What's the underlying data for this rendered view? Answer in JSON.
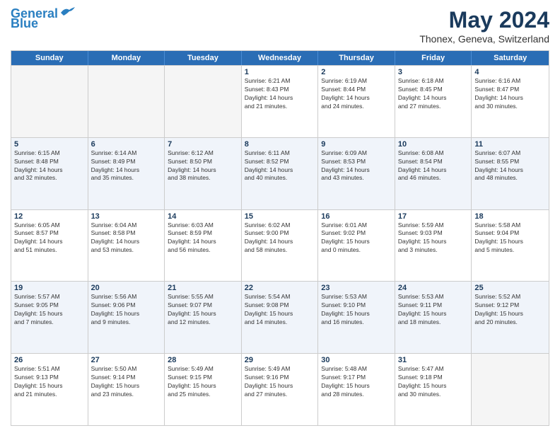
{
  "header": {
    "logo_line1": "General",
    "logo_line2": "Blue",
    "month_year": "May 2024",
    "location": "Thonex, Geneva, Switzerland"
  },
  "days_of_week": [
    "Sunday",
    "Monday",
    "Tuesday",
    "Wednesday",
    "Thursday",
    "Friday",
    "Saturday"
  ],
  "rows": [
    [
      {
        "day": "",
        "lines": []
      },
      {
        "day": "",
        "lines": []
      },
      {
        "day": "",
        "lines": []
      },
      {
        "day": "1",
        "lines": [
          "Sunrise: 6:21 AM",
          "Sunset: 8:43 PM",
          "Daylight: 14 hours",
          "and 21 minutes."
        ]
      },
      {
        "day": "2",
        "lines": [
          "Sunrise: 6:19 AM",
          "Sunset: 8:44 PM",
          "Daylight: 14 hours",
          "and 24 minutes."
        ]
      },
      {
        "day": "3",
        "lines": [
          "Sunrise: 6:18 AM",
          "Sunset: 8:45 PM",
          "Daylight: 14 hours",
          "and 27 minutes."
        ]
      },
      {
        "day": "4",
        "lines": [
          "Sunrise: 6:16 AM",
          "Sunset: 8:47 PM",
          "Daylight: 14 hours",
          "and 30 minutes."
        ]
      }
    ],
    [
      {
        "day": "5",
        "lines": [
          "Sunrise: 6:15 AM",
          "Sunset: 8:48 PM",
          "Daylight: 14 hours",
          "and 32 minutes."
        ]
      },
      {
        "day": "6",
        "lines": [
          "Sunrise: 6:14 AM",
          "Sunset: 8:49 PM",
          "Daylight: 14 hours",
          "and 35 minutes."
        ]
      },
      {
        "day": "7",
        "lines": [
          "Sunrise: 6:12 AM",
          "Sunset: 8:50 PM",
          "Daylight: 14 hours",
          "and 38 minutes."
        ]
      },
      {
        "day": "8",
        "lines": [
          "Sunrise: 6:11 AM",
          "Sunset: 8:52 PM",
          "Daylight: 14 hours",
          "and 40 minutes."
        ]
      },
      {
        "day": "9",
        "lines": [
          "Sunrise: 6:09 AM",
          "Sunset: 8:53 PM",
          "Daylight: 14 hours",
          "and 43 minutes."
        ]
      },
      {
        "day": "10",
        "lines": [
          "Sunrise: 6:08 AM",
          "Sunset: 8:54 PM",
          "Daylight: 14 hours",
          "and 46 minutes."
        ]
      },
      {
        "day": "11",
        "lines": [
          "Sunrise: 6:07 AM",
          "Sunset: 8:55 PM",
          "Daylight: 14 hours",
          "and 48 minutes."
        ]
      }
    ],
    [
      {
        "day": "12",
        "lines": [
          "Sunrise: 6:05 AM",
          "Sunset: 8:57 PM",
          "Daylight: 14 hours",
          "and 51 minutes."
        ]
      },
      {
        "day": "13",
        "lines": [
          "Sunrise: 6:04 AM",
          "Sunset: 8:58 PM",
          "Daylight: 14 hours",
          "and 53 minutes."
        ]
      },
      {
        "day": "14",
        "lines": [
          "Sunrise: 6:03 AM",
          "Sunset: 8:59 PM",
          "Daylight: 14 hours",
          "and 56 minutes."
        ]
      },
      {
        "day": "15",
        "lines": [
          "Sunrise: 6:02 AM",
          "Sunset: 9:00 PM",
          "Daylight: 14 hours",
          "and 58 minutes."
        ]
      },
      {
        "day": "16",
        "lines": [
          "Sunrise: 6:01 AM",
          "Sunset: 9:02 PM",
          "Daylight: 15 hours",
          "and 0 minutes."
        ]
      },
      {
        "day": "17",
        "lines": [
          "Sunrise: 5:59 AM",
          "Sunset: 9:03 PM",
          "Daylight: 15 hours",
          "and 3 minutes."
        ]
      },
      {
        "day": "18",
        "lines": [
          "Sunrise: 5:58 AM",
          "Sunset: 9:04 PM",
          "Daylight: 15 hours",
          "and 5 minutes."
        ]
      }
    ],
    [
      {
        "day": "19",
        "lines": [
          "Sunrise: 5:57 AM",
          "Sunset: 9:05 PM",
          "Daylight: 15 hours",
          "and 7 minutes."
        ]
      },
      {
        "day": "20",
        "lines": [
          "Sunrise: 5:56 AM",
          "Sunset: 9:06 PM",
          "Daylight: 15 hours",
          "and 9 minutes."
        ]
      },
      {
        "day": "21",
        "lines": [
          "Sunrise: 5:55 AM",
          "Sunset: 9:07 PM",
          "Daylight: 15 hours",
          "and 12 minutes."
        ]
      },
      {
        "day": "22",
        "lines": [
          "Sunrise: 5:54 AM",
          "Sunset: 9:08 PM",
          "Daylight: 15 hours",
          "and 14 minutes."
        ]
      },
      {
        "day": "23",
        "lines": [
          "Sunrise: 5:53 AM",
          "Sunset: 9:10 PM",
          "Daylight: 15 hours",
          "and 16 minutes."
        ]
      },
      {
        "day": "24",
        "lines": [
          "Sunrise: 5:53 AM",
          "Sunset: 9:11 PM",
          "Daylight: 15 hours",
          "and 18 minutes."
        ]
      },
      {
        "day": "25",
        "lines": [
          "Sunrise: 5:52 AM",
          "Sunset: 9:12 PM",
          "Daylight: 15 hours",
          "and 20 minutes."
        ]
      }
    ],
    [
      {
        "day": "26",
        "lines": [
          "Sunrise: 5:51 AM",
          "Sunset: 9:13 PM",
          "Daylight: 15 hours",
          "and 21 minutes."
        ]
      },
      {
        "day": "27",
        "lines": [
          "Sunrise: 5:50 AM",
          "Sunset: 9:14 PM",
          "Daylight: 15 hours",
          "and 23 minutes."
        ]
      },
      {
        "day": "28",
        "lines": [
          "Sunrise: 5:49 AM",
          "Sunset: 9:15 PM",
          "Daylight: 15 hours",
          "and 25 minutes."
        ]
      },
      {
        "day": "29",
        "lines": [
          "Sunrise: 5:49 AM",
          "Sunset: 9:16 PM",
          "Daylight: 15 hours",
          "and 27 minutes."
        ]
      },
      {
        "day": "30",
        "lines": [
          "Sunrise: 5:48 AM",
          "Sunset: 9:17 PM",
          "Daylight: 15 hours",
          "and 28 minutes."
        ]
      },
      {
        "day": "31",
        "lines": [
          "Sunrise: 5:47 AM",
          "Sunset: 9:18 PM",
          "Daylight: 15 hours",
          "and 30 minutes."
        ]
      },
      {
        "day": "",
        "lines": []
      }
    ]
  ]
}
